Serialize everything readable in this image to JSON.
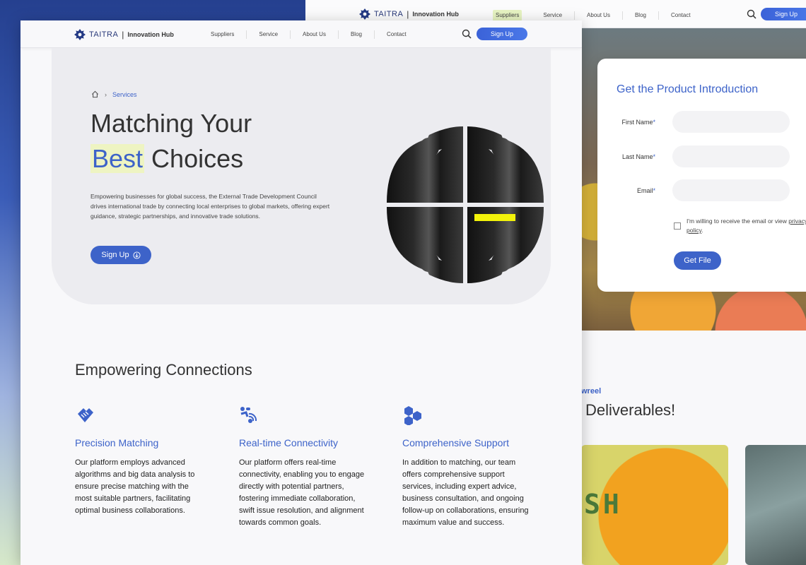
{
  "back_window": {
    "nav": {
      "brand": "TAITRA",
      "hub": "Innovation Hub",
      "links": [
        "Suppliers",
        "Service",
        "About Us",
        "Blog",
        "Contact"
      ],
      "active_link": "Suppliers",
      "signup": "Sign Up"
    },
    "form": {
      "title": "Get the Product Introduction",
      "first_name_label": "First Name",
      "last_name_label": "Last Name",
      "email_label": "Email",
      "required_mark": "*",
      "consent_text": "I'm willing to  receive the email or view ",
      "consent_link": "privacy policy",
      "consent_end": ".",
      "submit": "Get File"
    },
    "tagline": "wreel",
    "heading": "Deliverables!",
    "photo_text": "SH"
  },
  "front_window": {
    "nav": {
      "brand": "TAITRA",
      "hub": "Innovation Hub",
      "links": [
        "Suppliers",
        "Service",
        "About Us",
        "Blog",
        "Contact"
      ],
      "signup": "Sign Up"
    },
    "breadcrumb": {
      "current": "Services"
    },
    "hero": {
      "title_line1": "Matching Your",
      "title_highlight": "Best",
      "title_rest": " Choices",
      "description": "Empowering businesses for global success, the External Trade Development Council drives international trade by connecting local enterprises to global markets, offering expert guidance, strategic partnerships, and innovative trade solutions.",
      "cta": "Sign Up"
    },
    "section_title": "Empowering Connections",
    "features": [
      {
        "icon": "handshake-icon",
        "title": "Precision Matching",
        "text": "Our platform employs advanced algorithms and big data analysis to ensure precise matching with the most suitable partners, facilitating optimal business collaborations."
      },
      {
        "icon": "connectivity-icon",
        "title": "Real-time Connectivity",
        "text": "Our platform offers real-time connectivity, enabling you to engage directly with potential partners, fostering immediate collaboration, swift issue resolution, and alignment towards common goals."
      },
      {
        "icon": "hexagons-icon",
        "title": "Comprehensive Support",
        "text": "In addition to matching, our team offers comprehensive support services, including expert advice, business consultation, and ongoing follow-up on collaborations, ensuring maximum value and success."
      }
    ]
  },
  "colors": {
    "accent": "#3d63c9",
    "highlight": "#eef4c2",
    "text": "#333333",
    "hero_bg": "#ececf0"
  }
}
